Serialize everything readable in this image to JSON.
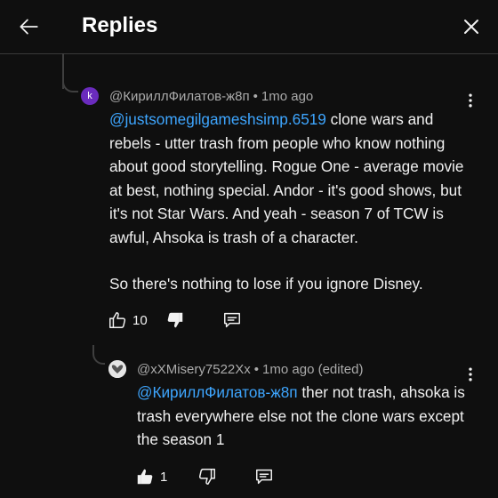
{
  "header": {
    "title": "Replies",
    "back_icon": "arrow-back-icon",
    "close_icon": "close-icon"
  },
  "colors": {
    "background": "#0f0f0f",
    "text": "#f1f1f1",
    "meta": "#aaaaaa",
    "mention": "#3ea6ff",
    "avatar_k": "#6a2bbd"
  },
  "comments": [
    {
      "avatar_letter": "k",
      "author": "@КириллФилатов-ж8п",
      "separator": "•",
      "time": "1mo ago",
      "mention": "@justsomegilgameshsimp.6519",
      "text": " clone wars and rebels - utter trash from people who know nothing about good storytelling. Rogue One - average movie at best,  nothing special. Andor - it's good shows, but it's not Star Wars. And yeah - season 7 of TCW is awful, Ahsoka is trash of a character.",
      "text2": "So there's nothing to lose if you ignore Disney.",
      "likes": "10",
      "liked": false
    },
    {
      "author": "@xXMisery7522Xx",
      "separator": "•",
      "time": "1mo ago (edited)",
      "mention": "@КириллФилатов-ж8п",
      "text": " ther not trash, ahsoka is trash everywhere else not the clone wars except the season 1",
      "likes": "1",
      "liked": true
    }
  ]
}
